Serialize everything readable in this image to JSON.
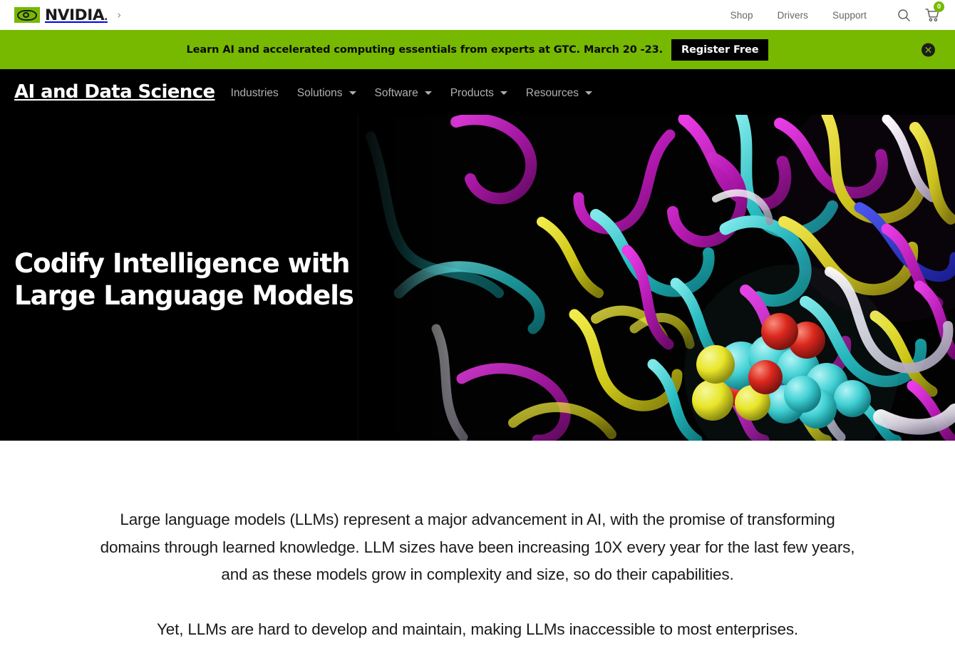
{
  "topbar": {
    "brand": "NVIDIA",
    "brand_dot": ".",
    "logo_chevron": "›",
    "links": [
      {
        "label": "Shop"
      },
      {
        "label": "Drivers"
      },
      {
        "label": "Support"
      }
    ],
    "search_icon": "search-icon",
    "cart_icon": "cart-icon",
    "cart_count": "0",
    "accent_color": "#76b900"
  },
  "promo": {
    "message": "Learn AI and accelerated computing essentials from experts at GTC. March 20 -23.",
    "cta_label": "Register Free",
    "close_icon": "close-icon",
    "background_color": "#76b900",
    "cta_background": "#000000"
  },
  "subnav": {
    "title": "AI and Data Science",
    "items": [
      {
        "label": "Industries",
        "has_dropdown": false
      },
      {
        "label": "Solutions",
        "has_dropdown": true
      },
      {
        "label": "Software",
        "has_dropdown": true
      },
      {
        "label": "Products",
        "has_dropdown": true
      },
      {
        "label": "Resources",
        "has_dropdown": true
      }
    ],
    "background_color": "#000000",
    "link_color": "#b0b0b0"
  },
  "hero": {
    "title_line1": "Codify Intelligence with",
    "title_line2": "Large Language Models",
    "background_color": "#000000",
    "artwork": "protein-ribbon-molecular-visualization",
    "artwork_colors": [
      "#c71ec7",
      "#2fd6d6",
      "#e6e01e",
      "#e81c1c",
      "#1f2fc8",
      "#e8e8f0"
    ]
  },
  "content": {
    "paragraphs": [
      "Large language models (LLMs) represent a major advancement in AI, with the promise of transforming domains through learned knowledge. LLM sizes have been increasing 10X every year for the last few years, and as these models grow in complexity and size, so do their capabilities.",
      "Yet, LLMs are hard to develop and maintain, making LLMs inaccessible to most enterprises."
    ]
  }
}
